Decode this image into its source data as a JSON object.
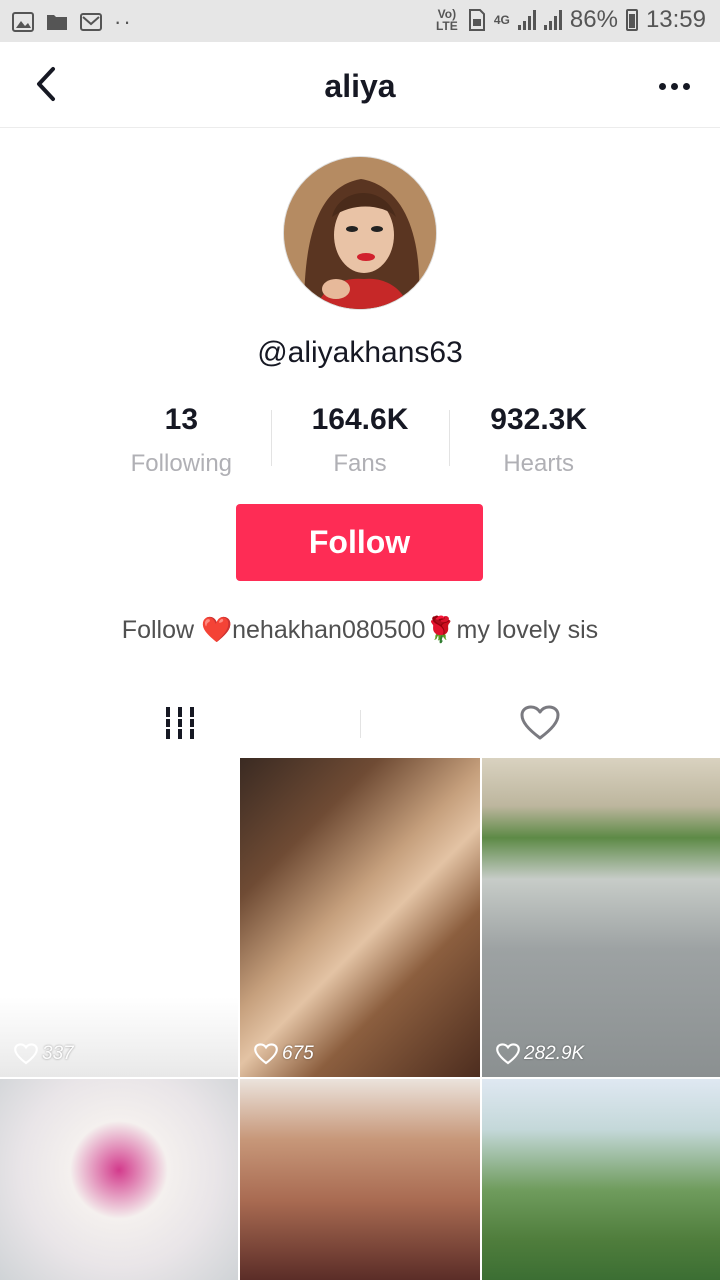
{
  "status_bar": {
    "network": "Vo) LTE",
    "data": "4G",
    "battery": "86%",
    "time": "13:59"
  },
  "header": {
    "title": "aliya",
    "back_icon": "chevron-left-icon",
    "more_icon": "more-horizontal-icon"
  },
  "profile": {
    "handle": "@aliyakhans63",
    "stats": [
      {
        "value": "13",
        "label": "Following"
      },
      {
        "value": "164.6K",
        "label": "Fans"
      },
      {
        "value": "932.3K",
        "label": "Hearts"
      }
    ],
    "follow_label": "Follow",
    "bio": "Follow ❤️nehakhan080500🌹my lovely sis"
  },
  "tabs": [
    {
      "icon": "videos-grid-icon",
      "active": true
    },
    {
      "icon": "heart-outline-icon",
      "active": false
    }
  ],
  "videos": [
    {
      "likes": "337"
    },
    {
      "likes": "675"
    },
    {
      "likes": "282.9K"
    },
    {
      "likes": ""
    },
    {
      "likes": ""
    },
    {
      "likes": ""
    }
  ],
  "colors": {
    "accent": "#fe2c55",
    "text": "#161823",
    "muted": "#b0b0b5"
  }
}
